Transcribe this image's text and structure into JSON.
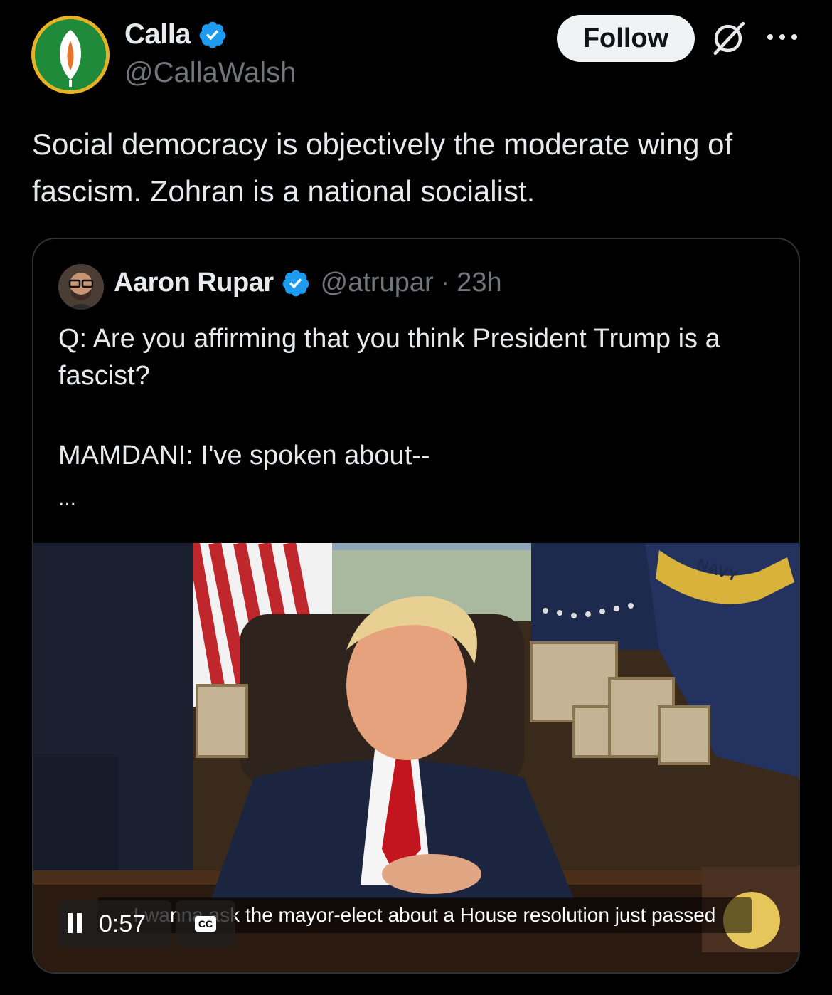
{
  "post": {
    "author": {
      "display_name": "Calla",
      "handle": "@CallaWalsh",
      "verified": true,
      "avatar_icon": "calla-lily-logo"
    },
    "follow_label": "Follow",
    "grok_icon": "grok-icon",
    "more_icon": "more-icon",
    "text": "Social democracy is objectively the moderate wing of fascism. Zohran is a national socialist."
  },
  "quote": {
    "author": {
      "display_name": "Aaron Rupar",
      "handle": "@atrupar",
      "verified": true,
      "separator": "·",
      "time": "23h"
    },
    "text_line1": "Q: Are you affirming that you think President Trump is a fascist?",
    "text_line2": "MAMDANI: I've spoken about--",
    "ellipsis": "...",
    "video": {
      "caption": "I wanna ask the mayor-elect about a House resolution just passed",
      "time": "0:57",
      "cc_label": "CC",
      "flag_text": "NAVY"
    }
  },
  "colors": {
    "background": "#000000",
    "text": "#e7e9ea",
    "muted": "#71767b",
    "verified_blue": "#1d9bf0",
    "border": "#2f3336"
  }
}
